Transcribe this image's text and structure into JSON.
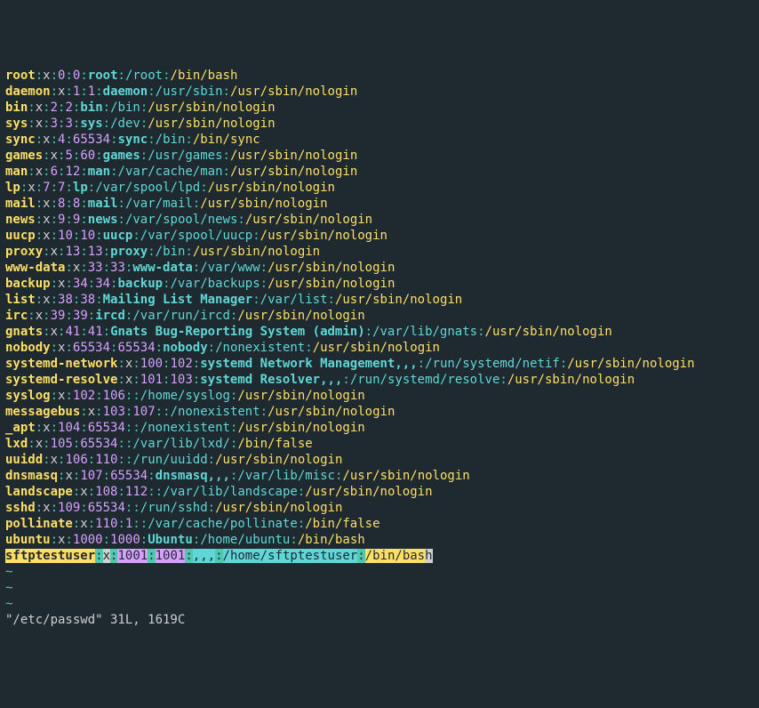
{
  "entries": [
    {
      "user": "root",
      "uid": "0",
      "gid": "0",
      "gecos": "root",
      "home": "/root",
      "shell": "/bin/bash"
    },
    {
      "user": "daemon",
      "uid": "1",
      "gid": "1",
      "gecos": "daemon",
      "home": "/usr/sbin",
      "shell": "/usr/sbin/nologin"
    },
    {
      "user": "bin",
      "uid": "2",
      "gid": "2",
      "gecos": "bin",
      "home": "/bin",
      "shell": "/usr/sbin/nologin"
    },
    {
      "user": "sys",
      "uid": "3",
      "gid": "3",
      "gecos": "sys",
      "home": "/dev",
      "shell": "/usr/sbin/nologin"
    },
    {
      "user": "sync",
      "uid": "4",
      "gid": "65534",
      "gecos": "sync",
      "home": "/bin",
      "shell": "/bin/sync"
    },
    {
      "user": "games",
      "uid": "5",
      "gid": "60",
      "gecos": "games",
      "home": "/usr/games",
      "shell": "/usr/sbin/nologin"
    },
    {
      "user": "man",
      "uid": "6",
      "gid": "12",
      "gecos": "man",
      "home": "/var/cache/man",
      "shell": "/usr/sbin/nologin"
    },
    {
      "user": "lp",
      "uid": "7",
      "gid": "7",
      "gecos": "lp",
      "home": "/var/spool/lpd",
      "shell": "/usr/sbin/nologin"
    },
    {
      "user": "mail",
      "uid": "8",
      "gid": "8",
      "gecos": "mail",
      "home": "/var/mail",
      "shell": "/usr/sbin/nologin"
    },
    {
      "user": "news",
      "uid": "9",
      "gid": "9",
      "gecos": "news",
      "home": "/var/spool/news",
      "shell": "/usr/sbin/nologin"
    },
    {
      "user": "uucp",
      "uid": "10",
      "gid": "10",
      "gecos": "uucp",
      "home": "/var/spool/uucp",
      "shell": "/usr/sbin/nologin"
    },
    {
      "user": "proxy",
      "uid": "13",
      "gid": "13",
      "gecos": "proxy",
      "home": "/bin",
      "shell": "/usr/sbin/nologin"
    },
    {
      "user": "www-data",
      "uid": "33",
      "gid": "33",
      "gecos": "www-data",
      "home": "/var/www",
      "shell": "/usr/sbin/nologin"
    },
    {
      "user": "backup",
      "uid": "34",
      "gid": "34",
      "gecos": "backup",
      "home": "/var/backups",
      "shell": "/usr/sbin/nologin"
    },
    {
      "user": "list",
      "uid": "38",
      "gid": "38",
      "gecos": "Mailing List Manager",
      "home": "/var/list",
      "shell": "/usr/sbin/nologin"
    },
    {
      "user": "irc",
      "uid": "39",
      "gid": "39",
      "gecos": "ircd",
      "home": "/var/run/ircd",
      "shell": "/usr/sbin/nologin"
    },
    {
      "user": "gnats",
      "uid": "41",
      "gid": "41",
      "gecos": "Gnats Bug-Reporting System (admin)",
      "home": "/var/lib/gnats",
      "shell": "/usr/sbin/nologin"
    },
    {
      "user": "nobody",
      "uid": "65534",
      "gid": "65534",
      "gecos": "nobody",
      "home": "/nonexistent",
      "shell": "/usr/sbin/nologin"
    },
    {
      "user": "systemd-network",
      "uid": "100",
      "gid": "102",
      "gecos": "systemd Network Management,,,",
      "home": "/run/systemd/netif",
      "shell": "/usr/sbin/nologin"
    },
    {
      "user": "systemd-resolve",
      "uid": "101",
      "gid": "103",
      "gecos": "systemd Resolver,,,",
      "home": "/run/systemd/resolve",
      "shell": "/usr/sbin/nologin"
    },
    {
      "user": "syslog",
      "uid": "102",
      "gid": "106",
      "gecos": "",
      "home": "/home/syslog",
      "shell": "/usr/sbin/nologin"
    },
    {
      "user": "messagebus",
      "uid": "103",
      "gid": "107",
      "gecos": "",
      "home": "/nonexistent",
      "shell": "/usr/sbin/nologin"
    },
    {
      "user": "_apt",
      "uid": "104",
      "gid": "65534",
      "gecos": "",
      "home": "/nonexistent",
      "shell": "/usr/sbin/nologin"
    },
    {
      "user": "lxd",
      "uid": "105",
      "gid": "65534",
      "gecos": "",
      "home": "/var/lib/lxd/",
      "shell": "/bin/false"
    },
    {
      "user": "uuidd",
      "uid": "106",
      "gid": "110",
      "gecos": "",
      "home": "/run/uuidd",
      "shell": "/usr/sbin/nologin"
    },
    {
      "user": "dnsmasq",
      "uid": "107",
      "gid": "65534",
      "gecos": "dnsmasq,,,",
      "home": "/var/lib/misc",
      "shell": "/usr/sbin/nologin"
    },
    {
      "user": "landscape",
      "uid": "108",
      "gid": "112",
      "gecos": "",
      "home": "/var/lib/landscape",
      "shell": "/usr/sbin/nologin"
    },
    {
      "user": "sshd",
      "uid": "109",
      "gid": "65534",
      "gecos": "",
      "home": "/run/sshd",
      "shell": "/usr/sbin/nologin"
    },
    {
      "user": "pollinate",
      "uid": "110",
      "gid": "1",
      "gecos": "",
      "home": "/var/cache/pollinate",
      "shell": "/bin/false"
    },
    {
      "user": "ubuntu",
      "uid": "1000",
      "gid": "1000",
      "gecos": "Ubuntu",
      "home": "/home/ubuntu",
      "shell": "/bin/bash"
    }
  ],
  "selected_entry": {
    "user": "sftptestuser",
    "uid": "1001",
    "gid": "1001",
    "gecos": ",,,",
    "home": "/home/sftptestuser",
    "shell": "/bin/bas",
    "cursor": "h"
  },
  "tilde": "~",
  "status": "\"/etc/passwd\" 31L, 1619C"
}
